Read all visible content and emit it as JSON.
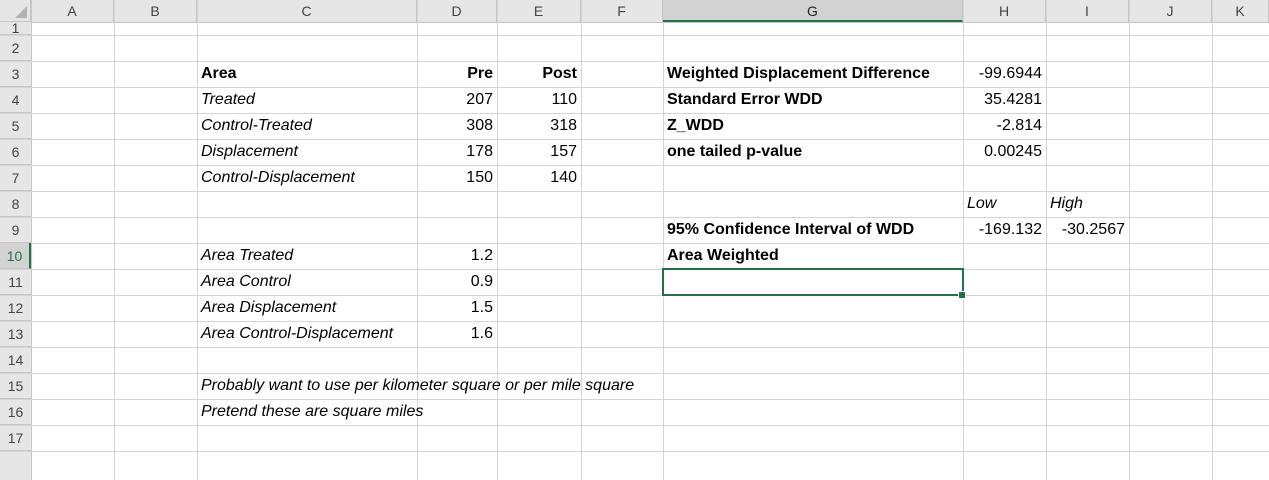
{
  "columns": [
    "A",
    "B",
    "C",
    "D",
    "E",
    "F",
    "G",
    "H",
    "I",
    "J",
    "K"
  ],
  "rows": [
    "1",
    "2",
    "3",
    "4",
    "5",
    "6",
    "7",
    "8",
    "9",
    "10",
    "11",
    "12",
    "13",
    "14",
    "15",
    "16",
    "17"
  ],
  "active_cell": {
    "col": "G",
    "row": "10"
  },
  "table": {
    "header": {
      "area": "Area",
      "pre": "Pre",
      "post": "Post"
    },
    "rows": [
      {
        "area": "Treated",
        "pre": "207",
        "post": "110"
      },
      {
        "area": "Control-Treated",
        "pre": "308",
        "post": "318"
      },
      {
        "area": "Displacement",
        "pre": "178",
        "post": "157"
      },
      {
        "area": "Control-Displacement",
        "pre": "150",
        "post": "140"
      }
    ]
  },
  "areas": [
    {
      "label": "Area Treated",
      "value": "1.2"
    },
    {
      "label": "Area Control",
      "value": "0.9"
    },
    {
      "label": "Area Displacement",
      "value": "1.5"
    },
    {
      "label": "Area Control-Displacement",
      "value": "1.6"
    }
  ],
  "stats": [
    {
      "label": "Weighted Displacement Difference",
      "value": "-99.6944"
    },
    {
      "label": "Standard Error WDD",
      "value": "35.4281"
    },
    {
      "label": "Z_WDD",
      "value": "-2.814"
    },
    {
      "label": "one tailed p-value",
      "value": "0.00245"
    }
  ],
  "ci": {
    "low_label": "Low",
    "high_label": "High",
    "label": "95% Confidence Interval of WDD",
    "low": "-169.132",
    "high": "-30.2567"
  },
  "area_weighted_label": "Area Weighted",
  "notes": [
    "Probably want to use per kilometer square or per mile square",
    "Pretend these are square miles"
  ],
  "colors": {
    "accent": "#217346",
    "header_bg": "#e6e6e6",
    "gridline": "#d4d4d4"
  }
}
